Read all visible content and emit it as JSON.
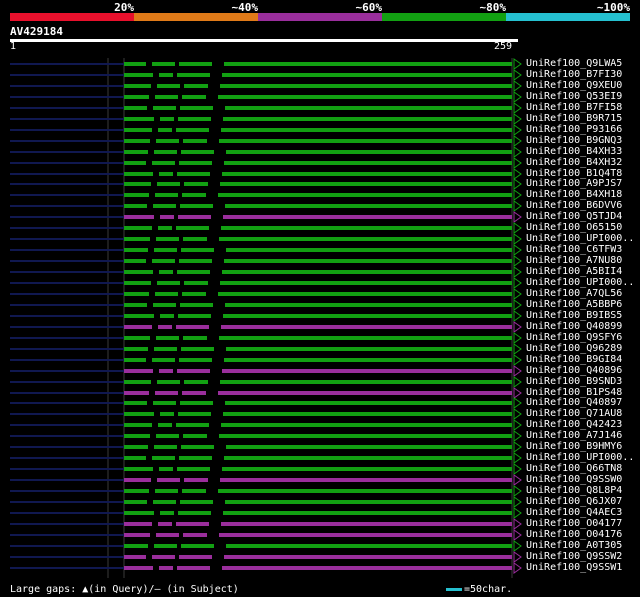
{
  "header": {
    "scale_labels": [
      "20%",
      "~40%",
      "~60%",
      "~80%",
      "~100%"
    ],
    "scale_colors": [
      "#e8102c",
      "#e07a18",
      "#9a2e9c",
      "#12a012",
      "#25c0d0"
    ],
    "query_name": "AV429184",
    "query_start": "1",
    "query_end": "259"
  },
  "hits": [
    {
      "label": "UniRef100_Q9LWA5",
      "identity_color": "#12a012"
    },
    {
      "label": "UniRef100_B7FI30",
      "identity_color": "#12a012"
    },
    {
      "label": "UniRef100_Q9XEU0",
      "identity_color": "#12a012"
    },
    {
      "label": "UniRef100_Q53EI9",
      "identity_color": "#12a012"
    },
    {
      "label": "UniRef100_B7FI58",
      "identity_color": "#12a012"
    },
    {
      "label": "UniRef100_B9R715",
      "identity_color": "#12a012"
    },
    {
      "label": "UniRef100_P93166",
      "identity_color": "#12a012"
    },
    {
      "label": "UniRef100_B9GNQ3",
      "identity_color": "#12a012"
    },
    {
      "label": "UniRef100_B4XH33",
      "identity_color": "#12a012"
    },
    {
      "label": "UniRef100_B4XH32",
      "identity_color": "#12a012"
    },
    {
      "label": "UniRef100_B1Q4T8",
      "identity_color": "#12a012"
    },
    {
      "label": "UniRef100_A9PJS7",
      "identity_color": "#12a012"
    },
    {
      "label": "UniRef100_B4XH18",
      "identity_color": "#12a012"
    },
    {
      "label": "UniRef100_B6DVV6",
      "identity_color": "#12a012"
    },
    {
      "label": "UniRef100_Q5TJD4",
      "identity_color": "#9a2e9c"
    },
    {
      "label": "UniRef100_O65150",
      "identity_color": "#12a012"
    },
    {
      "label": "UniRef100_UPI000..",
      "identity_color": "#12a012"
    },
    {
      "label": "UniRef100_C6TFW3",
      "identity_color": "#12a012"
    },
    {
      "label": "UniRef100_A7NU80",
      "identity_color": "#12a012"
    },
    {
      "label": "UniRef100_A5BII4",
      "identity_color": "#12a012"
    },
    {
      "label": "UniRef100_UPI000..",
      "identity_color": "#12a012"
    },
    {
      "label": "UniRef100_A7QL56",
      "identity_color": "#12a012"
    },
    {
      "label": "UniRef100_A5BBP6",
      "identity_color": "#12a012"
    },
    {
      "label": "UniRef100_B9IBS5",
      "identity_color": "#12a012"
    },
    {
      "label": "UniRef100_Q40899",
      "identity_color": "#9a2e9c"
    },
    {
      "label": "UniRef100_Q9SFY6",
      "identity_color": "#12a012"
    },
    {
      "label": "UniRef100_Q96289",
      "identity_color": "#12a012"
    },
    {
      "label": "UniRef100_B9GI84",
      "identity_color": "#12a012"
    },
    {
      "label": "UniRef100_Q40896",
      "identity_color": "#9a2e9c"
    },
    {
      "label": "UniRef100_B9SND3",
      "identity_color": "#12a012"
    },
    {
      "label": "UniRef100_B1PS48",
      "identity_color": "#9a2e9c"
    },
    {
      "label": "UniRef100_Q40897",
      "identity_color": "#12a012"
    },
    {
      "label": "UniRef100_Q71AU8",
      "identity_color": "#12a012"
    },
    {
      "label": "UniRef100_Q42423",
      "identity_color": "#12a012"
    },
    {
      "label": "UniRef100_A7J146",
      "identity_color": "#12a012"
    },
    {
      "label": "UniRef100_B9HMY6",
      "identity_color": "#12a012"
    },
    {
      "label": "UniRef100_UPI000..",
      "identity_color": "#12a012"
    },
    {
      "label": "UniRef100_Q66TN8",
      "identity_color": "#12a012"
    },
    {
      "label": "UniRef100_Q9SSW0",
      "identity_color": "#9a2e9c"
    },
    {
      "label": "UniRef100_Q8L8P4",
      "identity_color": "#12a012"
    },
    {
      "label": "UniRef100_Q6JX07",
      "identity_color": "#12a012"
    },
    {
      "label": "UniRef100_Q4AEC3",
      "identity_color": "#12a012"
    },
    {
      "label": "UniRef100_O04177",
      "identity_color": "#9a2e9c"
    },
    {
      "label": "UniRef100_O04176",
      "identity_color": "#9a2e9c"
    },
    {
      "label": "UniRef100_A0T305",
      "identity_color": "#12a012"
    },
    {
      "label": "UniRef100_Q9SSW2",
      "identity_color": "#9a2e9c"
    },
    {
      "label": "UniRef100_Q9SSW1",
      "identity_color": "#9a2e9c"
    }
  ],
  "footer": {
    "legend_text": "Large gaps: ▲(in Query)/– (in Subject)",
    "scale_text": "=50char."
  }
}
